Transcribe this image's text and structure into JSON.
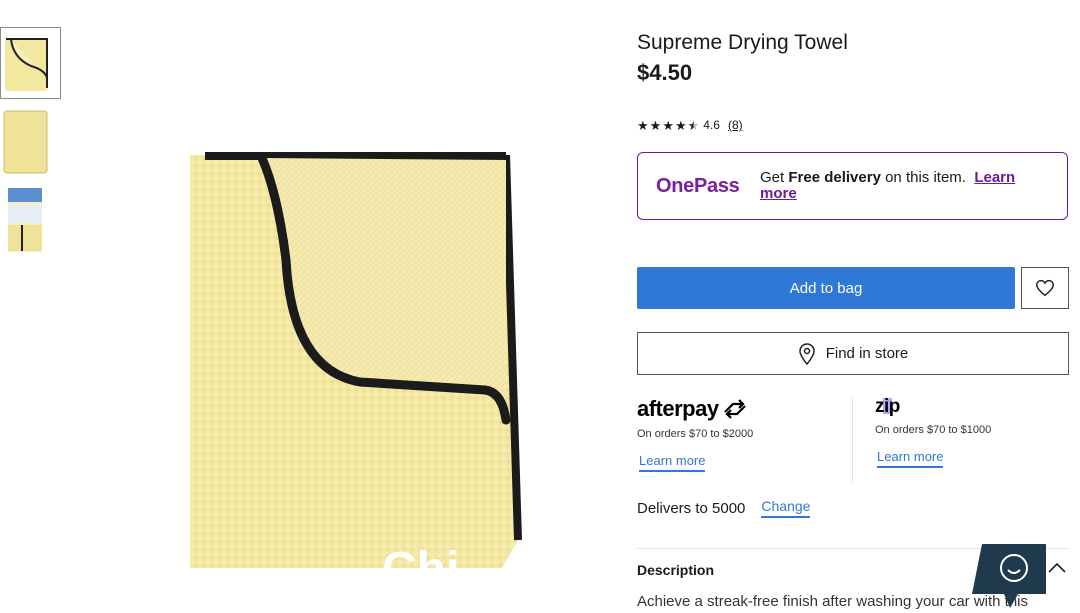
{
  "gallery": {
    "thumbnails": [
      {
        "alt": "towel folded view",
        "active": true
      },
      {
        "alt": "towel flat view",
        "active": false
      },
      {
        "alt": "towel packaged view",
        "active": false
      }
    ],
    "image_overlay_text": "Chi"
  },
  "product": {
    "title": "Supreme Drying Towel",
    "price": "$4.50",
    "rating_value": "4.6",
    "rating_count": "(8)",
    "stars": 4.5
  },
  "onepass": {
    "logo_text": "OnePass",
    "text_prefix": "Get ",
    "text_bold": "Free delivery",
    "text_suffix": " on this item.",
    "link_label": "Learn more",
    "color": "#6a1b9a"
  },
  "actions": {
    "add_to_bag_label": "Add to bag",
    "find_in_store_label": "Find in store",
    "wishlist_icon": "heart-icon",
    "accent_color": "#2f78d7"
  },
  "payment_options": {
    "afterpay": {
      "logo_text": "afterpay",
      "subtitle": "On orders $70 to $2000",
      "link_label": "Learn more"
    },
    "zip": {
      "logo_text": "zip",
      "subtitle": "On orders $70 to $1000",
      "link_label": "Learn more"
    }
  },
  "delivery": {
    "text": "Delivers to 5000",
    "change_label": "Change"
  },
  "description": {
    "title": "Description",
    "text": "Achieve a streak-free finish after washing your car with this"
  }
}
